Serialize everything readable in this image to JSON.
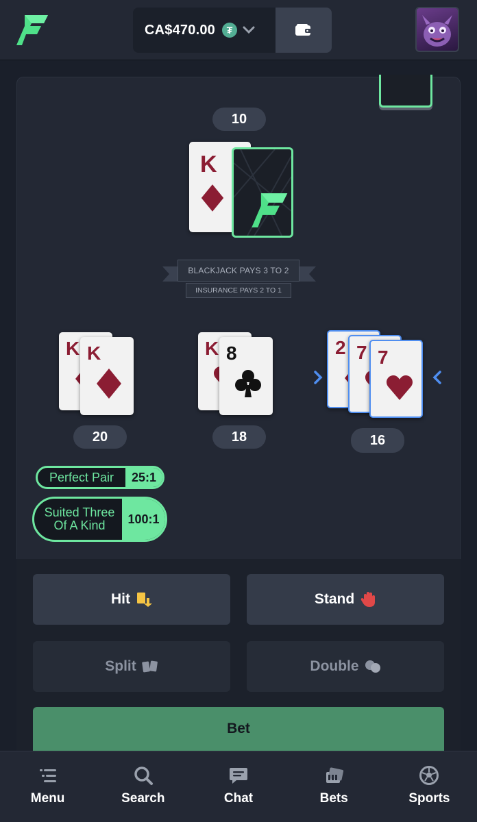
{
  "header": {
    "balance": "CA$470.00",
    "currency_icon": "tether-icon",
    "currency_symbol": "₮",
    "brand_color": "#6ee7a0"
  },
  "dealer": {
    "score": "10",
    "cards": [
      {
        "rank": "K",
        "suit": "diamond"
      },
      {
        "face": "down"
      }
    ]
  },
  "table_rules": {
    "main": "BLACKJACK PAYS 3 TO 2",
    "sub": "INSURANCE PAYS 2 TO 1"
  },
  "hands": [
    {
      "score": "20",
      "cards": [
        {
          "rank": "K",
          "suit": "diamond"
        },
        {
          "rank": "K",
          "suit": "diamond"
        }
      ]
    },
    {
      "score": "18",
      "cards": [
        {
          "rank": "K",
          "suit": "heart"
        },
        {
          "rank": "8",
          "suit": "club"
        }
      ]
    },
    {
      "score": "16",
      "active": true,
      "cards": [
        {
          "rank": "2",
          "suit": "diamond"
        },
        {
          "rank": "7",
          "suit": "heart"
        },
        {
          "rank": "7",
          "suit": "heart"
        }
      ]
    }
  ],
  "side_bets": [
    {
      "label": "Perfect Pair",
      "payout": "25:1"
    },
    {
      "label": "Suited Three Of A Kind",
      "payout": "100:1"
    }
  ],
  "controls": {
    "hit": "Hit",
    "stand": "Stand",
    "split": "Split",
    "double": "Double",
    "bet": "Bet"
  },
  "nav": [
    {
      "label": "Menu",
      "icon": "menu-icon"
    },
    {
      "label": "Search",
      "icon": "search-icon"
    },
    {
      "label": "Chat",
      "icon": "chat-icon"
    },
    {
      "label": "Bets",
      "icon": "bets-icon"
    },
    {
      "label": "Sports",
      "icon": "soccer-ball-icon"
    }
  ]
}
